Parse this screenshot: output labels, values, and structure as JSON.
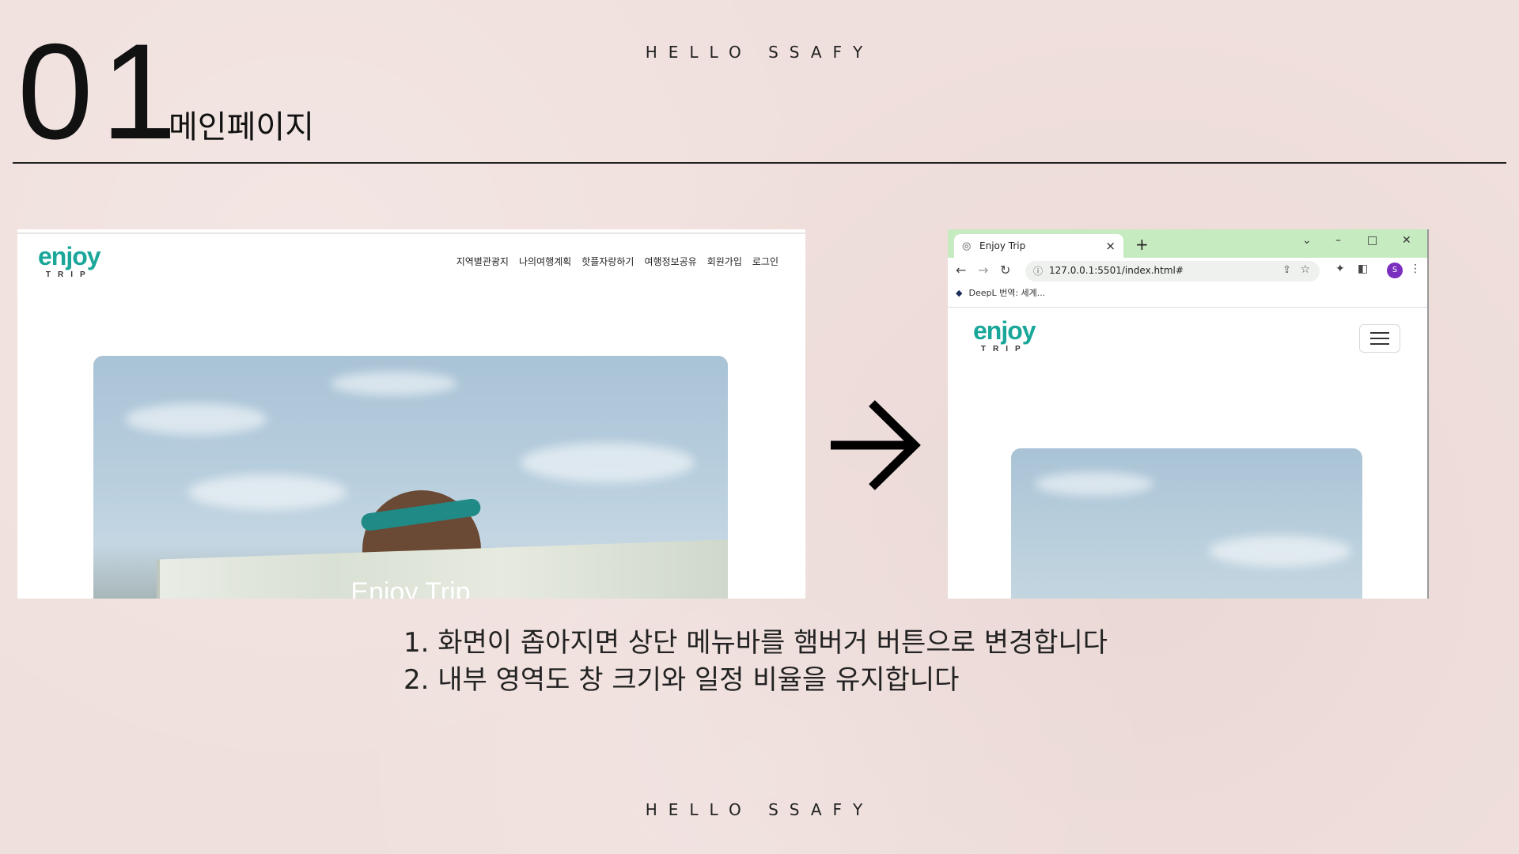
{
  "slide": {
    "header": "HELLO SSAFY",
    "footer": "HELLO SSAFY",
    "number": "01",
    "subtitle": "메인페이지",
    "description": [
      "1. 화면이 좁아지면 상단 메뉴바를 햄버거 버튼으로 변경합니다",
      "2. 내부 영역도 창 크기와 일정 비율을 유지합니다"
    ]
  },
  "desktop_page": {
    "logo_word": "enjoy",
    "logo_sub": "TRIP",
    "nav_items": [
      "지역별관광지",
      "나의여행계획",
      "핫플자랑하기",
      "여행정보공유",
      "회원가입",
      "로그인"
    ],
    "hero_title": "Enjoy Trip"
  },
  "browser": {
    "tab_title": "Enjoy Trip",
    "url": "127.0.0.1:5501/index.html#",
    "bookmark_label": "DeepL 번역: 세계...",
    "profile_initial": "S",
    "tabbar_color": "#c7ebc0",
    "logo_word": "enjoy",
    "logo_sub": "TRIP"
  },
  "colors": {
    "background": "#f0e0dd",
    "logo_teal": "#1aa79a",
    "logo_blue": "#2a7fd1",
    "profile": "#7b2fbf"
  }
}
